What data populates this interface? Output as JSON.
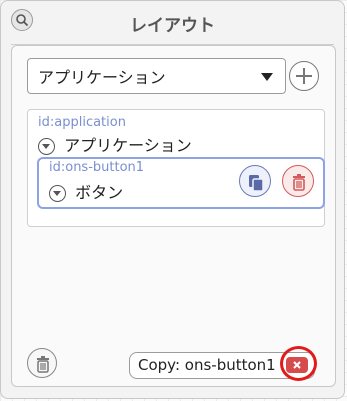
{
  "header": {
    "title": "レイアウト"
  },
  "select": {
    "value": "アプリケーション"
  },
  "tree": {
    "root": {
      "id": "id:application",
      "label": "アプリケーション"
    },
    "child": {
      "id": "id:ons-button1",
      "label": "ボタン"
    }
  },
  "footer": {
    "copy_value": "Copy: ons-button1"
  },
  "colors": {
    "accent": "#8fa2e6",
    "danger": "#d45a5a",
    "ring": "#e11a1a"
  },
  "icons": [
    "search-icon",
    "plus-icon",
    "chevron-down-icon",
    "copy-icon",
    "trash-icon",
    "backspace-icon"
  ]
}
